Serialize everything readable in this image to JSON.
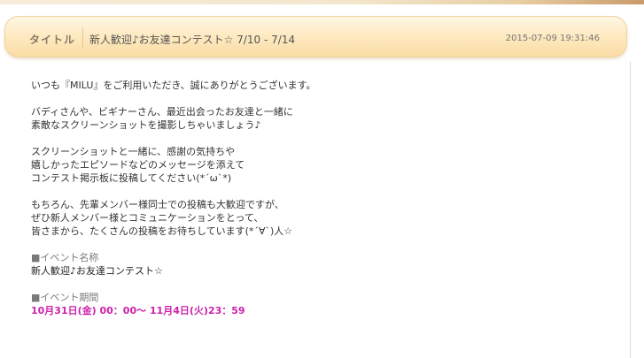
{
  "header": {
    "label": "タイトル",
    "title": "新人歓迎♪お友達コンテスト☆ 7/10 - 7/14",
    "datetime": "2015-07-09 19:31:46"
  },
  "body": {
    "paragraphs": [
      [
        "いつも『MILU』をご利用いただき、誠にありがとうございます。"
      ],
      [
        "バディさんや、ビギナーさん、最近出会ったお友達と一緒に",
        "素敵なスクリーンショットを撮影しちゃいましょう♪"
      ],
      [
        "スクリーンショットと一緒に、感謝の気持ちや",
        "嬉しかったエピソードなどのメッセージを添えて",
        "コンテスト掲示板に投稿してください(*´ω`*)"
      ],
      [
        "もちろん、先輩メンバー様同士での投稿も大歓迎ですが、",
        "ぜひ新人メンバー様とコミュニケーションをとって、",
        "皆さまから、たくさんの投稿をお待ちしています(*´∀`)人☆"
      ]
    ],
    "event_name": {
      "heading": "■イベント名称",
      "value": "新人歓迎♪お友達コンテスト☆"
    },
    "event_period": {
      "heading": "■イベント期間",
      "value": "10月31日(金) 00：00～ 11月4日(火)23：59"
    }
  },
  "colors": {
    "header_bg": "#fde8bd",
    "header_border": "#efd3a1",
    "period_accent": "#cc22aa"
  }
}
